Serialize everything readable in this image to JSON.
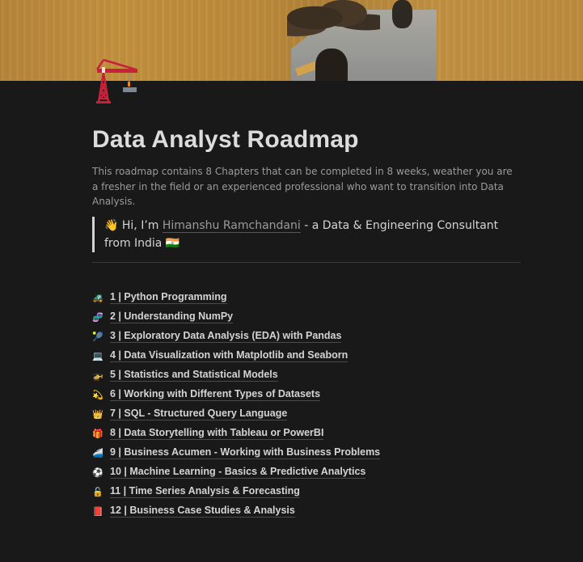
{
  "cover": {
    "description": "painting cover image"
  },
  "page_icon": "construction-crane-icon",
  "title": "Data Analyst Roadmap",
  "description": "This roadmap contains 8 Chapters that can be completed in 8 weeks, weather you are a fresher in the field or an experienced professional who want to transition into Data Analysis.",
  "callout": {
    "emoji": "👋",
    "prefix": "Hi, I’m ",
    "link_text": "Himanshu Ramchandani",
    "suffix": " - a Data & Engineering Consultant from India",
    "flag": "🇮🇳"
  },
  "chapters": [
    {
      "icon": "🚜",
      "icon_name": "tractor-icon",
      "label": "1 | Python Programming"
    },
    {
      "icon": "🧬",
      "icon_name": "dna-icon",
      "label": "2 | Understanding NumPy"
    },
    {
      "icon": "🎾",
      "icon_name": "tennis-ball-icon",
      "label": "3 | Exploratory Data Analysis (EDA) with Pandas"
    },
    {
      "icon": "💻",
      "icon_name": "laptop-icon",
      "label": "4 | Data Visualization with Matplotlib and Seaborn"
    },
    {
      "icon": "🚁",
      "icon_name": "helicopter-icon",
      "label": "5 | Statistics and Statistical Models"
    },
    {
      "icon": "💫",
      "icon_name": "sparkle-icon",
      "label": "6 | Working with Different Types of Datasets"
    },
    {
      "icon": "👑",
      "icon_name": "crown-icon",
      "label": "7 | SQL - Structured Query Language"
    },
    {
      "icon": "🎁",
      "icon_name": "gift-icon",
      "label": "8 | Data Storytelling with Tableau or PowerBI"
    },
    {
      "icon": "🚄",
      "icon_name": "train-icon",
      "label": "9 | Business Acumen - Working with Business Problems"
    },
    {
      "icon": "⚽",
      "icon_name": "soccer-ball-icon",
      "label": "10 | Machine Learning - Basics & Predictive Analytics"
    },
    {
      "icon": "🔓",
      "icon_name": "unlock-icon",
      "label": "11 | Time Series Analysis & Forecasting"
    },
    {
      "icon": "📕",
      "icon_name": "book-icon",
      "label": "12 | Business Case Studies & Analysis"
    }
  ]
}
